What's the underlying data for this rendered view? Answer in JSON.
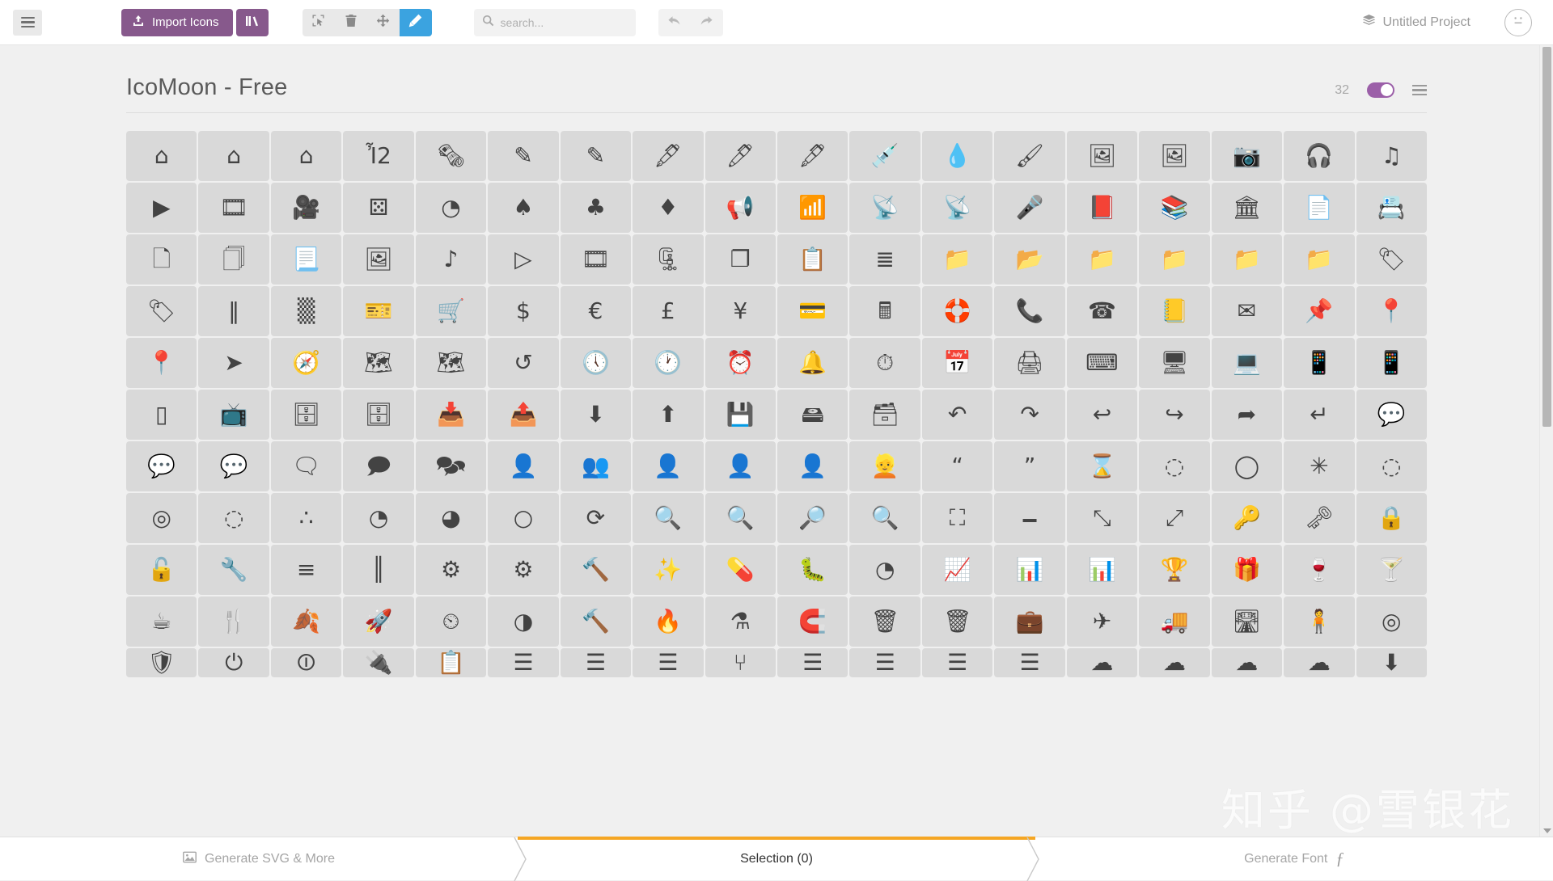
{
  "toolbar": {
    "menu_button": "menu-icon",
    "import_label": "Import Icons",
    "import_icon": "upload-icon",
    "library_icon": "library-icon",
    "tools": [
      {
        "name": "select-tool",
        "icon": "cursor-select-icon",
        "active": false
      },
      {
        "name": "delete-tool",
        "icon": "trash-icon",
        "active": false
      },
      {
        "name": "move-tool",
        "icon": "move-arrows-icon",
        "active": false
      },
      {
        "name": "edit-tool",
        "icon": "pencil-icon",
        "active": true
      }
    ],
    "search_placeholder": "search...",
    "search_value": "",
    "search_icon": "magnifier-icon",
    "history": [
      {
        "name": "undo-button",
        "icon": "undo-arrow-icon"
      },
      {
        "name": "redo-button",
        "icon": "redo-arrow-icon"
      }
    ],
    "project_name": "Untitled Project",
    "project_icon": "layers-icon",
    "avatar_icon": "neutral-face-icon",
    "accent_purple": "#87598c",
    "accent_blue": "#3ba3e0"
  },
  "set": {
    "title": "IcoMoon - Free",
    "grid_size": "32",
    "toggle_on": true,
    "toggle_color": "#9b5fa8",
    "menu_icon": "hamburger-menu-icon",
    "tile_bg": "#d9d9d9",
    "icon_color": "#434343"
  },
  "icons": [
    "home",
    "home2",
    "home3",
    "office",
    "newspaper",
    "pencil",
    "pencil2",
    "quill",
    "pen",
    "blog",
    "eyedropper",
    "droplet",
    "paint-format",
    "image",
    "images",
    "camera",
    "headphones",
    "music",
    "play",
    "film",
    "video-camera",
    "dice",
    "pacman",
    "spades",
    "clubs",
    "diamonds",
    "bullhorn",
    "connection",
    "podcast",
    "feed",
    "mic",
    "book",
    "books",
    "library",
    "file-text",
    "profile",
    "file-empty",
    "files-empty",
    "file-text2",
    "file-picture",
    "file-music",
    "file-play",
    "file-video",
    "file-zip",
    "copy",
    "paste",
    "stack",
    "folder",
    "folder-open",
    "folder-plus",
    "folder-minus",
    "folder-download",
    "folder-upload",
    "price-tag",
    "price-tags",
    "barcode",
    "qrcode",
    "ticket",
    "cart",
    "coin-dollar",
    "coin-euro",
    "coin-pound",
    "coin-yen",
    "credit-card",
    "calculator",
    "lifebuoy",
    "phone",
    "phone-hang-up",
    "address-book",
    "envelop",
    "pushpin",
    "location",
    "location2",
    "compass",
    "compass2",
    "map",
    "map2",
    "history",
    "clock",
    "clock2",
    "alarm",
    "bell",
    "stopwatch",
    "calendar",
    "printer",
    "keyboard",
    "display",
    "laptop",
    "mobile",
    "mobile2",
    "tablet",
    "tv",
    "drawer",
    "drawer2",
    "box-add",
    "box-remove",
    "download",
    "upload",
    "floppy-disk",
    "drive",
    "database",
    "undo",
    "redo",
    "undo2",
    "redo2",
    "forward",
    "reply",
    "bubble",
    "bubbles",
    "bubbles2",
    "bubble2",
    "bubbles3",
    "bubbles4",
    "user",
    "users",
    "user-plus",
    "user-minus",
    "user-check",
    "user-tie",
    "quotes-left",
    "quotes-right",
    "hour-glass",
    "spinner",
    "spinner2",
    "spinner3",
    "spinner4",
    "spinner5",
    "spinner6",
    "spinner7",
    "spinner8",
    "spinner9",
    "spinner10",
    "spinner11",
    "binoculars",
    "search",
    "zoom-in",
    "zoom-out",
    "enlarge",
    "shrink",
    "enlarge2",
    "shrink2",
    "key",
    "key2",
    "lock",
    "unlocked",
    "wrench",
    "equalizer",
    "equalizer2",
    "cog",
    "cogs",
    "hammer",
    "magic-wand",
    "aid-kit",
    "bug",
    "pie-chart",
    "stats-dots",
    "stats-bars",
    "stats-bars2",
    "trophy",
    "gift",
    "glass",
    "glass2",
    "mug",
    "spoon-knife",
    "leaf",
    "rocket",
    "meter",
    "meter2",
    "hammer2",
    "fire",
    "lab",
    "magnet",
    "bin",
    "bin2",
    "briefcase",
    "airplane",
    "truck",
    "road",
    "accessibility",
    "target"
  ],
  "partial_row_icons": [
    "shield",
    "power",
    "switch",
    "power-cord",
    "clipboard",
    "list-numbered",
    "list",
    "list2",
    "tree",
    "menu",
    "menu2",
    "menu3",
    "menu4",
    "cloud",
    "cloud-download",
    "cloud-upload",
    "cloud-check",
    "download2"
  ],
  "bottom": {
    "tabs": [
      {
        "name": "generate-svg-tab",
        "label": "Generate SVG & More",
        "icon": "image-icon",
        "active": false
      },
      {
        "name": "selection-tab",
        "label": "Selection (0)",
        "icon": "",
        "active": true
      },
      {
        "name": "generate-font-tab",
        "label": "Generate Font",
        "icon": "font-f-icon",
        "active": false
      }
    ],
    "active_accent": "#f5a623"
  },
  "watermark": "知乎 @雪银花",
  "scrollbar": {
    "thumb_color": "#b6b6b6"
  }
}
